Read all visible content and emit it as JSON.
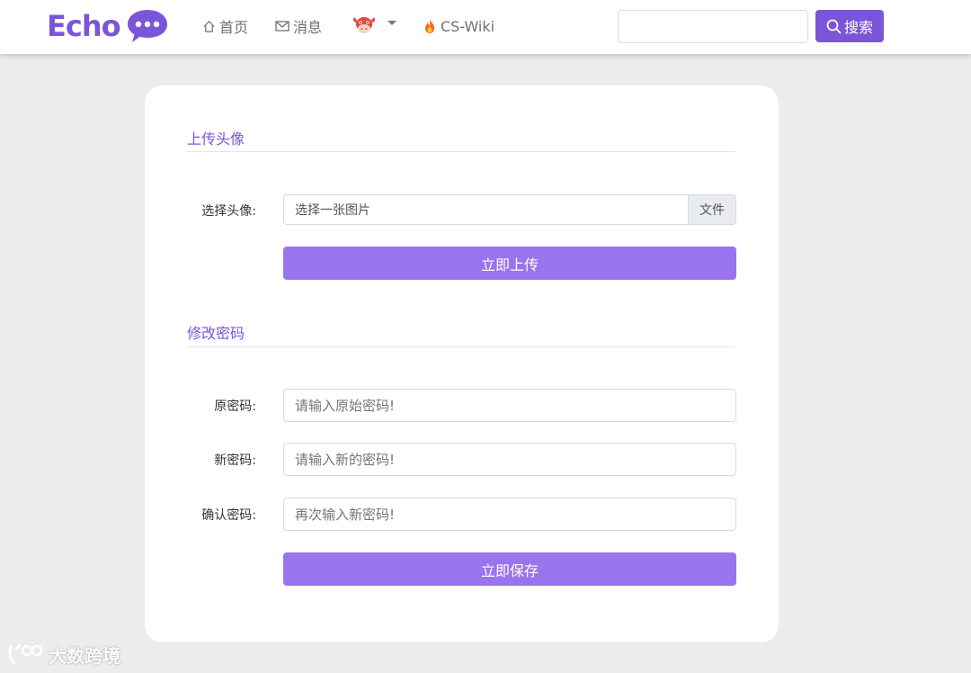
{
  "header": {
    "brand": "Echo",
    "nav": {
      "home": "首页",
      "messages": "消息",
      "wiki": "CS-Wiki"
    },
    "search": {
      "placeholder": "",
      "button_label": "搜索"
    },
    "accent_color": "#7b55d8"
  },
  "avatar_section": {
    "title": "上传头像",
    "label": "选择头像:",
    "file_placeholder": "选择一张图片",
    "file_button": "文件",
    "upload_button": "立即上传"
  },
  "password_section": {
    "title": "修改密码",
    "fields": [
      {
        "label": "原密码:",
        "placeholder": "请输入原始密码!"
      },
      {
        "label": "新密码:",
        "placeholder": "请输入新的密码!"
      },
      {
        "label": "确认密码:",
        "placeholder": "再次输入新密码!"
      }
    ],
    "save_button": "立即保存"
  },
  "watermark": "大数跨境",
  "icons": [
    "chat-bubble-icon",
    "home-icon",
    "envelope-icon",
    "cow-avatar-icon",
    "fire-icon",
    "search-icon"
  ]
}
